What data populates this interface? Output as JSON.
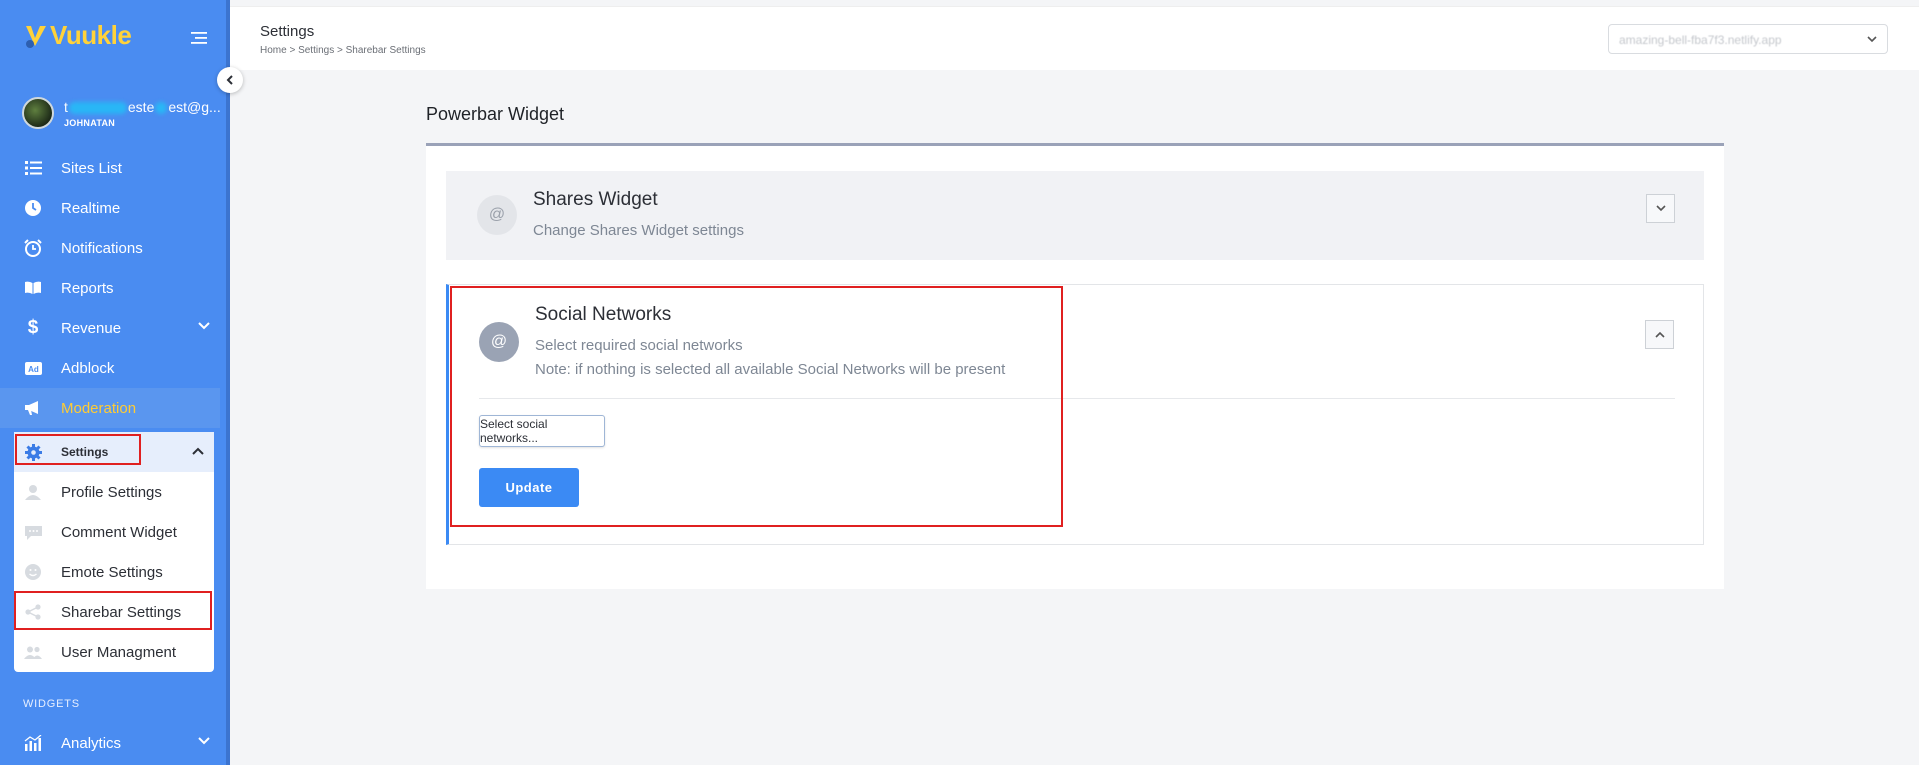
{
  "app": {
    "brand": "Vuukle"
  },
  "user": {
    "email_prefix": "t",
    "email_mid": "este",
    "email_suffix": "est@g...",
    "name": "JOHNATAN"
  },
  "sidebar": {
    "items": [
      {
        "label": "Sites List",
        "icon": "list-icon"
      },
      {
        "label": "Realtime",
        "icon": "clock-icon"
      },
      {
        "label": "Notifications",
        "icon": "alarm-icon"
      },
      {
        "label": "Reports",
        "icon": "book-icon"
      },
      {
        "label": "Revenue",
        "icon": "dollar-icon"
      },
      {
        "label": "Adblock",
        "icon": "ad-icon"
      },
      {
        "label": "Moderation",
        "icon": "megaphone-icon"
      }
    ],
    "settings": {
      "label": "Settings",
      "items": [
        {
          "label": "Profile Settings",
          "icon": "user-icon"
        },
        {
          "label": "Comment Widget",
          "icon": "comment-icon"
        },
        {
          "label": "Emote Settings",
          "icon": "smile-icon"
        },
        {
          "label": "Sharebar Settings",
          "icon": "share-icon"
        },
        {
          "label": "User Managment",
          "icon": "users-icon"
        }
      ]
    },
    "section_widgets": "WIDGETS",
    "analytics": "Analytics"
  },
  "header": {
    "title": "Settings",
    "breadcrumb": "Home  > Settings > Sharebar Settings",
    "site_selected": "amazing-bell-fba7f3.netlify.app"
  },
  "main": {
    "title": "Powerbar Widget",
    "shares": {
      "icon_glyph": "@",
      "title": "Shares Widget",
      "subtitle": "Change Shares Widget settings"
    },
    "social": {
      "icon_glyph": "@",
      "title": "Social Networks",
      "subtitle": "Select required social networks",
      "note": "Note: if nothing is selected all available Social Networks will be present",
      "select_label": "Select social networks...",
      "update_label": "Update"
    }
  },
  "colors": {
    "sidebar": "#4a8cf1",
    "accent": "#3b8af4",
    "highlight": "#e02020",
    "brand": "#ffd23a"
  }
}
